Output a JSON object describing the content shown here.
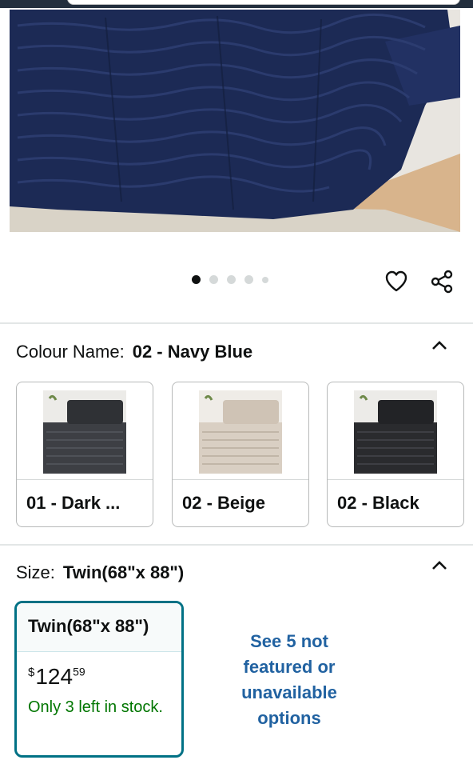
{
  "hero": {
    "image_alt": "Navy blue seersucker comforter on bed"
  },
  "carousel": {
    "dot_count": 5,
    "active_index": 0
  },
  "icons": {
    "wishlist": "heart-icon",
    "share": "share-icon",
    "collapse": "chevron-up-icon"
  },
  "colour": {
    "label": "Colour Name:",
    "selected": "02 - Navy Blue",
    "options": [
      {
        "name": "01 - Dark ...",
        "tone": "#3d3f44"
      },
      {
        "name": "02 - Beige",
        "tone": "#d9cfc3"
      },
      {
        "name": "02 - Black",
        "tone": "#2a2b2e"
      }
    ]
  },
  "size": {
    "label": "Size:",
    "selected": "Twin(68\"x 88\")",
    "option": {
      "name": "Twin(68\"x 88\")",
      "currency": "$",
      "price_whole": "124",
      "price_fraction": "59",
      "stock": "Only 3 left in stock."
    },
    "more_link": "See 5 not featured or unavailable options"
  },
  "colors": {
    "accent": "#007185",
    "link": "#2162a1",
    "stock": "#007600",
    "navy": "#1c2a55"
  }
}
